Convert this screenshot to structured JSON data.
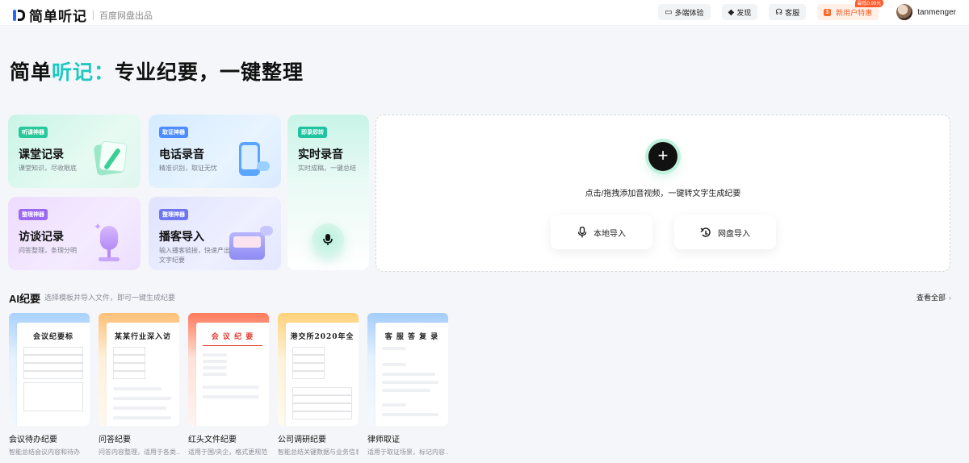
{
  "header": {
    "logo_text": "简单听记",
    "logo_sub": "百度网盘出品",
    "actions": [
      {
        "label": "多端体验",
        "icon": "devices-icon"
      },
      {
        "label": "发现",
        "icon": "discover-icon"
      },
      {
        "label": "客服",
        "icon": "headset-icon"
      }
    ],
    "promo": {
      "label": "新用户特惠",
      "tag": "最低0.99元",
      "icon": "gift-icon"
    },
    "username": "tanmenger"
  },
  "hero": {
    "part1": "简单",
    "highlight": "听记",
    "colon": "：",
    "rest": "专业纪要，一键整理"
  },
  "cards": {
    "class_record": {
      "tag": "听课神器",
      "title": "课堂记录",
      "desc": "课堂知识，尽收眼底"
    },
    "phone_record": {
      "tag": "取证神器",
      "title": "电话录音",
      "desc": "精准识别，取证无忧"
    },
    "interview": {
      "tag": "整理神器",
      "title": "访谈记录",
      "desc": "问答整理，条理分明"
    },
    "podcast": {
      "tag": "整理神器",
      "title": "播客导入",
      "desc": "输入播客链接，快速产出文字纪要"
    },
    "realtime": {
      "tag": "即录即转",
      "title": "实时录音",
      "desc": "实时成稿，一键总结"
    }
  },
  "upload": {
    "hint": "点击/拖拽添加音视频，一键转文字生成纪要",
    "local_label": "本地导入",
    "cloud_label": "网盘导入"
  },
  "ai_section": {
    "title": "AI纪要",
    "subtitle": "选择模板并导入文件，即可一键生成纪要",
    "see_all": "查看全部"
  },
  "templates": [
    {
      "doc_title": "会议纪要标",
      "name": "会议待办纪要",
      "sub": "智能总结会议内容和待办"
    },
    {
      "doc_title": "某某行业深入访",
      "name": "问答纪要",
      "sub": "问答内容整理，适用于各类..."
    },
    {
      "doc_title": "会 议 纪 要",
      "name": "红头文件纪要",
      "sub": "适用于国/央企，格式更规范"
    },
    {
      "doc_title": "港交所2020年全",
      "name": "公司调研纪要",
      "sub": "智能总结关键数据与业务信息"
    },
    {
      "doc_title": "客 服 答 复 录",
      "name": "律师取证",
      "sub": "适用于取证场景，标记内容..."
    }
  ],
  "colors": {
    "accent": "#1ec8c0",
    "promo": "#f0612b"
  }
}
